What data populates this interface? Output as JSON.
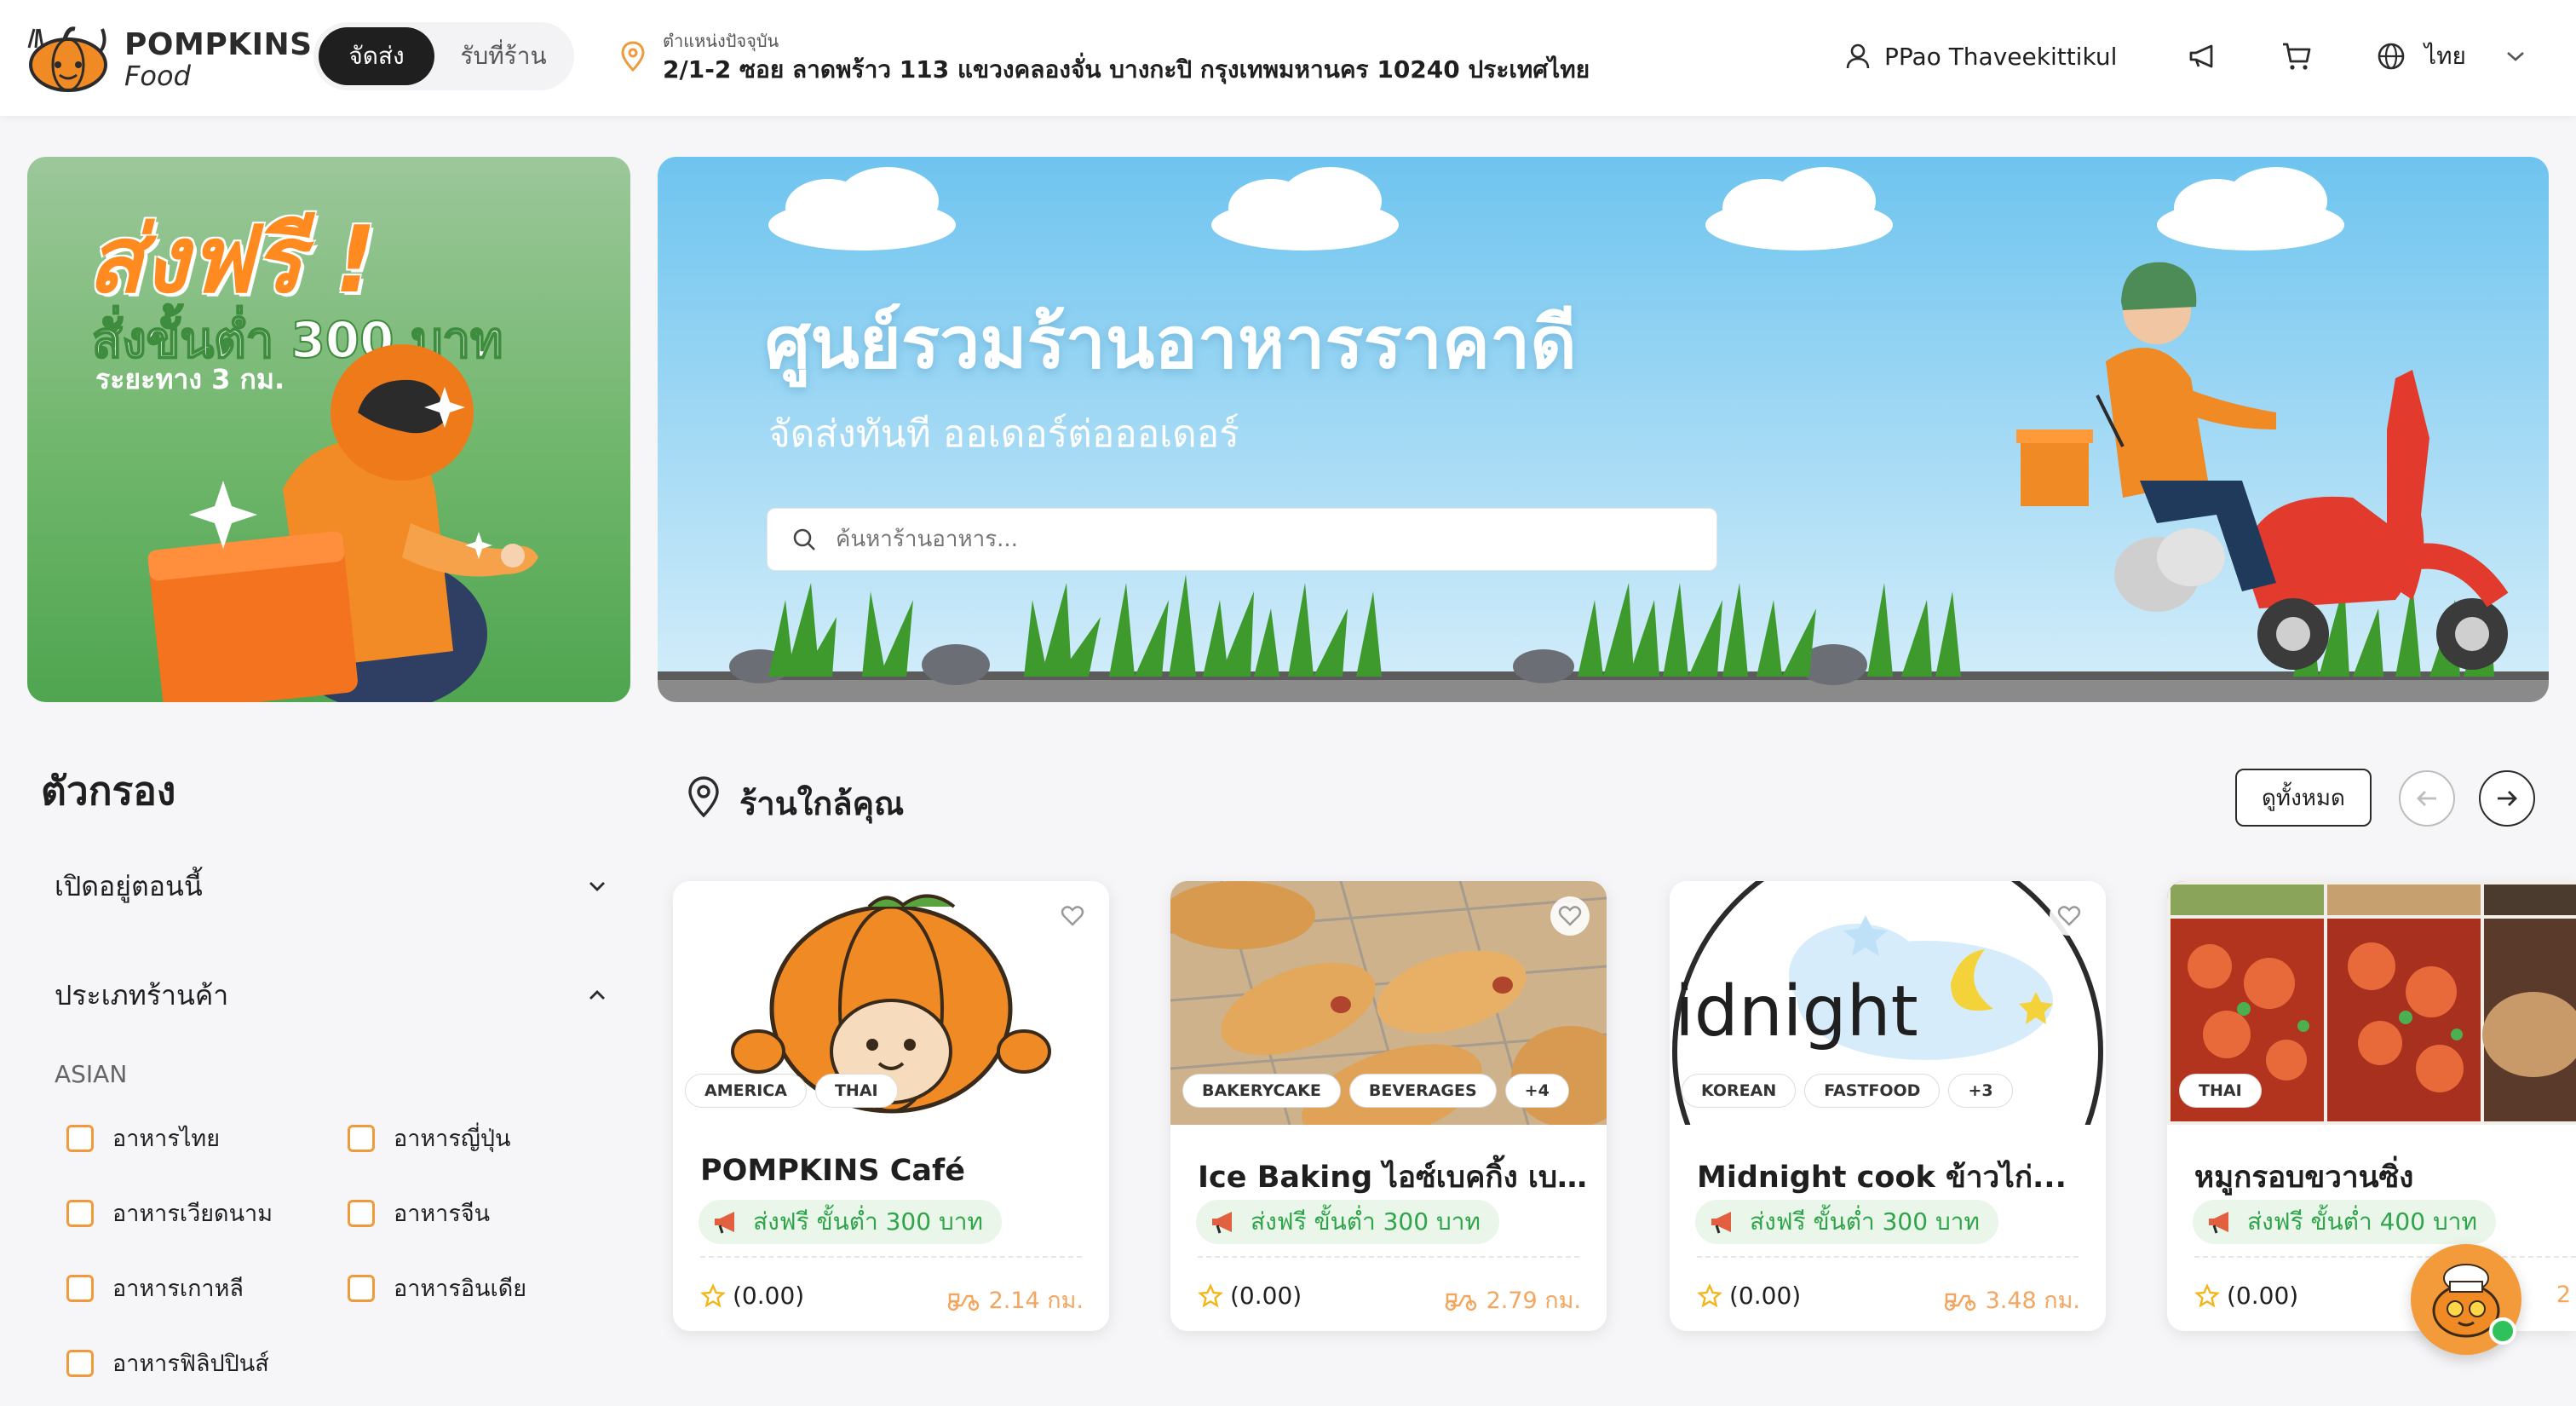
{
  "header": {
    "brand_line1": "POMPKINS",
    "brand_line2": "Food",
    "mode_delivery": "จัดส่ง",
    "mode_pickup": "รับที่ร้าน",
    "location_label": "ตำแหน่งปัจจุบัน",
    "location_value": "2/1-2 ซอย ลาดพร้าว 113 แขวงคลองจั่น บางกะปิ กรุงเทพมหานคร 10240 ประเทศไทย",
    "user_name": "PPao Thaveekittikul",
    "language": "ไทย",
    "icons": [
      "user-icon",
      "megaphone-icon",
      "cart-icon",
      "globe-icon",
      "chevron-down-icon"
    ]
  },
  "promo": {
    "headline": "ส่งฟรี !",
    "min_order": "สั่งขั้นต่ำ 300 บาท",
    "distance": "ระยะทาง 3 กม."
  },
  "hero": {
    "title": "ศูนย์รวมร้านอาหารราคาดี",
    "subtitle": "จัดส่งทันที ออเดอร์ต่อออเดอร์",
    "search_placeholder": "ค้นหาร้านอาหาร..."
  },
  "filters": {
    "title": "ตัวกรอง",
    "open_now": "เปิดอยู่ตอนนี้",
    "store_type": "ประเภทร้านค้า",
    "group_label": "ASIAN",
    "options": [
      "อาหารไทย",
      "อาหารญี่ปุ่น",
      "อาหารเวียดนาม",
      "อาหารจีน",
      "อาหารเกาหลี",
      "อาหารอินเดีย",
      "อาหารฟิลิปปินส์"
    ]
  },
  "nearby": {
    "title": "ร้านใกล้คุณ",
    "view_all": "ดูทั้งหมด"
  },
  "restaurants": [
    {
      "name": "POMPKINS Café",
      "tags": [
        "AMERICA",
        "THAI"
      ],
      "promo": "ส่งฟรี ขั้นต่ำ 300 บาท",
      "rating": "(0.00)",
      "distance": "2.14 กม."
    },
    {
      "name": "Ice Baking ไอซ์เบคกิ้ง เบเ...",
      "tags": [
        "BAKERYCAKE",
        "BEVERAGES",
        "+4"
      ],
      "promo": "ส่งฟรี ขั้นต่ำ 300 บาท",
      "rating": "(0.00)",
      "distance": "2.79 กม."
    },
    {
      "name": "Midnight cook ข้าวไก่...",
      "tags": [
        "KOREAN",
        "FASTFOOD",
        "+3"
      ],
      "promo": "ส่งฟรี ขั้นต่ำ 300 บาท",
      "rating": "(0.00)",
      "distance": "3.48 กม."
    },
    {
      "name": "หมูกรอบขวานซิ่ง",
      "tags": [
        "THAI"
      ],
      "promo": "ส่งฟรี ขั้นต่ำ 400 บาท",
      "rating": "(0.00)",
      "distance": "2"
    }
  ],
  "card_logo_text": "idnight",
  "colors": {
    "accent": "#ff8a1f",
    "promo_green": "#2fa44a",
    "dark": "#1f1f1f"
  }
}
